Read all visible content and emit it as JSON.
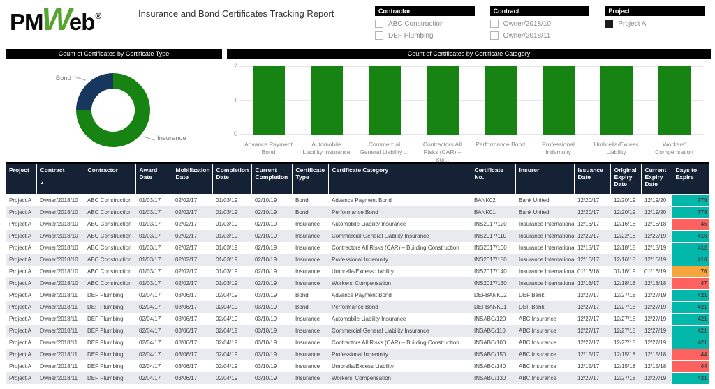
{
  "header": {
    "logo_pm": "PM",
    "logo_w": "W",
    "logo_eb": "eb",
    "logo_reg": "®",
    "title": "Insurance and Bond Certificates Tracking Report"
  },
  "colors": {
    "accent_green": "#168312",
    "dark_navy": "#17375E",
    "table_header_bg": "#152235",
    "title_bar_bg": "#000000",
    "logo_green": "#56A52E",
    "status_ok": "#01B8AA",
    "status_warning": "#F8A63C",
    "status_critical": "#FD625E"
  },
  "slicers": [
    {
      "title": "Contractor",
      "items": [
        {
          "label": "ABC Construction",
          "checked": false
        },
        {
          "label": "DEF Plumbing",
          "checked": false
        }
      ]
    },
    {
      "title": "Contract",
      "items": [
        {
          "label": "Owner/2018/10",
          "checked": false
        },
        {
          "label": "Owner/2018/11",
          "checked": false
        }
      ]
    },
    {
      "title": "Project",
      "items": [
        {
          "label": "Project A",
          "checked": true
        }
      ]
    }
  ],
  "chart_data": [
    {
      "type": "pie",
      "donut": true,
      "title": "Count of Certificates by Certificate Type",
      "slices": [
        {
          "label": "Bond",
          "value": 4,
          "color": "#17375E"
        },
        {
          "label": "Insurance",
          "value": 12,
          "color": "#168312"
        }
      ],
      "legend_position": "callout-labels"
    },
    {
      "type": "bar",
      "title": "Count of Certificates by Certificate Category",
      "categories": [
        "Advance Payment Bond",
        "Automobile Liability Insurance",
        "Commercial General Liability ...",
        "Contractors All Risks (CAR) – Bui...",
        "Performance Bond",
        "Professional Indemnity",
        "Umbrella/Excess Liability",
        "Workers' Compensation"
      ],
      "values": [
        2,
        2,
        2,
        2,
        2,
        2,
        2,
        2
      ],
      "xlabel": "",
      "ylabel": "",
      "ylim": [
        0,
        2
      ],
      "yticks": [
        0,
        1,
        2
      ],
      "grid": true,
      "bar_color": "#168312"
    }
  ],
  "table": {
    "sort_icon": "▲",
    "columns": [
      {
        "label": "Project"
      },
      {
        "label": "Contract",
        "sorted": true
      },
      {
        "label": "Contractor"
      },
      {
        "label": "Award Date"
      },
      {
        "label": "Mobilization Date"
      },
      {
        "label": "Completion Date"
      },
      {
        "label": "Current Completion"
      },
      {
        "label": "Certificate Type"
      },
      {
        "label": "Certificate Category"
      },
      {
        "label": "Certificate No."
      },
      {
        "label": "Insurer"
      },
      {
        "label": "Issuance Date"
      },
      {
        "label": "Original Expiry Date"
      },
      {
        "label": "Current Expiry Date"
      },
      {
        "label": "Days to Expire"
      }
    ],
    "rows": [
      {
        "cells": [
          "Project A",
          "Owner/2018/10",
          "ABC Construction",
          "01/03/17",
          "02/02/17",
          "01/03/19",
          "02/10/19",
          "Bond",
          "Advance Payment Bond",
          "BANK02",
          "Bank United",
          "12/20/17",
          "12/20/19",
          "12/19/20"
        ],
        "days_to_expire": "779",
        "days_status": "ok"
      },
      {
        "cells": [
          "Project A",
          "Owner/2018/10",
          "ABC Construction",
          "01/03/17",
          "02/02/17",
          "01/03/19",
          "02/10/19",
          "Bond",
          "Performance Bond",
          "BANK01",
          "Bank United",
          "12/20/17",
          "12/20/19",
          "12/19/20"
        ],
        "days_to_expire": "779",
        "days_status": "ok"
      },
      {
        "cells": [
          "Project A",
          "Owner/2018/10",
          "ABC Construction",
          "01/03/17",
          "02/02/17",
          "01/03/19",
          "02/10/19",
          "Insurance",
          "Automobile Liability Insurance",
          "INS2017/120",
          "Insurance International",
          "12/16/17",
          "12/16/18",
          "12/16/18"
        ],
        "days_to_expire": "45",
        "days_status": "critical"
      },
      {
        "cells": [
          "Project A",
          "Owner/2018/10",
          "ABC Construction",
          "01/03/17",
          "02/02/17",
          "01/03/19",
          "02/10/19",
          "Insurance",
          "Commercial General Liability Insurance",
          "INS2017/110",
          "Insurance International",
          "12/22/17",
          "12/22/18",
          "12/22/19"
        ],
        "days_to_expire": "416",
        "days_status": "ok"
      },
      {
        "cells": [
          "Project A",
          "Owner/2018/10",
          "ABC Construction",
          "01/03/17",
          "02/02/17",
          "01/03/19",
          "02/10/19",
          "Insurance",
          "Contractors All Risks (CAR) – Building Construction",
          "INS2017/100",
          "Insurance International",
          "12/18/17",
          "12/18/18",
          "12/18/19"
        ],
        "days_to_expire": "412",
        "days_status": "ok"
      },
      {
        "cells": [
          "Project A",
          "Owner/2018/10",
          "ABC Construction",
          "01/03/17",
          "02/02/17",
          "01/03/19",
          "02/10/19",
          "Insurance",
          "Professional Indemnity",
          "INS2017/150",
          "Insurance International",
          "12/16/17",
          "12/16/18",
          "12/16/19"
        ],
        "days_to_expire": "410",
        "days_status": "ok"
      },
      {
        "cells": [
          "Project A",
          "Owner/2018/10",
          "ABC Construction",
          "01/03/17",
          "02/02/17",
          "01/03/19",
          "02/10/19",
          "Insurance",
          "Umbrella/Excess Liability",
          "INS2017/140",
          "Insurance International",
          "01/16/18",
          "01/16/19",
          "01/16/19"
        ],
        "days_to_expire": "76",
        "days_status": "warning"
      },
      {
        "cells": [
          "Project A",
          "Owner/2018/10",
          "ABC Construction",
          "01/03/17",
          "02/02/17",
          "01/03/19",
          "02/10/19",
          "Insurance",
          "Workers' Compensation",
          "INS2017/130",
          "Insurance International",
          "12/18/17",
          "12/18/18",
          "12/18/18"
        ],
        "days_to_expire": "47",
        "days_status": "critical"
      },
      {
        "cells": [
          "Project A",
          "Owner/2018/11",
          "DEF Plumbing",
          "02/04/17",
          "03/06/17",
          "02/04/19",
          "03/10/19",
          "Bond",
          "Advance Payment Bond",
          "DEFBANK02",
          "DEF Bank",
          "12/27/17",
          "12/27/18",
          "12/27/19"
        ],
        "days_to_expire": "421",
        "days_status": "ok"
      },
      {
        "cells": [
          "Project A",
          "Owner/2018/11",
          "DEF Plumbing",
          "02/04/17",
          "03/06/17",
          "02/04/19",
          "03/10/19",
          "Bond",
          "Performance Bond",
          "DEFBANK01",
          "DEF Bank",
          "12/27/17",
          "12/27/18",
          "12/27/19"
        ],
        "days_to_expire": "421",
        "days_status": "ok"
      },
      {
        "cells": [
          "Project A",
          "Owner/2018/11",
          "DEF Plumbing",
          "02/04/17",
          "03/06/17",
          "02/04/19",
          "03/10/19",
          "Insurance",
          "Automobile Liability Insurance",
          "INSABC/120",
          "ABC Insurance",
          "12/27/17",
          "12/27/18",
          "12/27/19"
        ],
        "days_to_expire": "421",
        "days_status": "ok"
      },
      {
        "cells": [
          "Project A",
          "Owner/2018/11",
          "DEF Plumbing",
          "02/04/17",
          "03/06/17",
          "02/04/19",
          "03/10/19",
          "Insurance",
          "Commercial General Liability Insurance",
          "INSABC/110",
          "ABC Insurance",
          "12/27/17",
          "12/27/18",
          "12/27/19"
        ],
        "days_to_expire": "421",
        "days_status": "ok"
      },
      {
        "cells": [
          "Project A",
          "Owner/2018/11",
          "DEF Plumbing",
          "02/04/17",
          "03/06/17",
          "02/04/19",
          "03/10/19",
          "Insurance",
          "Contractors All Risks (CAR) – Building Construction",
          "INSABC/100",
          "ABC Insurance",
          "12/27/17",
          "12/27/18",
          "12/27/19"
        ],
        "days_to_expire": "421",
        "days_status": "ok"
      },
      {
        "cells": [
          "Project A",
          "Owner/2018/11",
          "DEF Plumbing",
          "02/04/17",
          "03/06/17",
          "02/04/19",
          "03/10/19",
          "Insurance",
          "Professional Indemnity",
          "INSABC/150",
          "ABC Insurance",
          "12/15/17",
          "12/15/18",
          "12/15/18"
        ],
        "days_to_expire": "44",
        "days_status": "critical"
      },
      {
        "cells": [
          "Project A",
          "Owner/2018/11",
          "DEF Plumbing",
          "02/04/17",
          "03/06/17",
          "02/04/19",
          "03/10/19",
          "Insurance",
          "Umbrella/Excess Liability",
          "INSABC/140",
          "ABC Insurance",
          "12/15/17",
          "12/15/18",
          "12/15/18"
        ],
        "days_to_expire": "44",
        "days_status": "critical"
      },
      {
        "cells": [
          "Project A",
          "Owner/2018/11",
          "DEF Plumbing",
          "02/04/17",
          "03/06/17",
          "02/04/19",
          "03/10/19",
          "Insurance",
          "Workers' Compensation",
          "INSABC/130",
          "ABC Insurance",
          "12/27/17",
          "12/27/18",
          "12/27/19"
        ],
        "days_to_expire": "421",
        "days_status": "ok"
      }
    ]
  }
}
